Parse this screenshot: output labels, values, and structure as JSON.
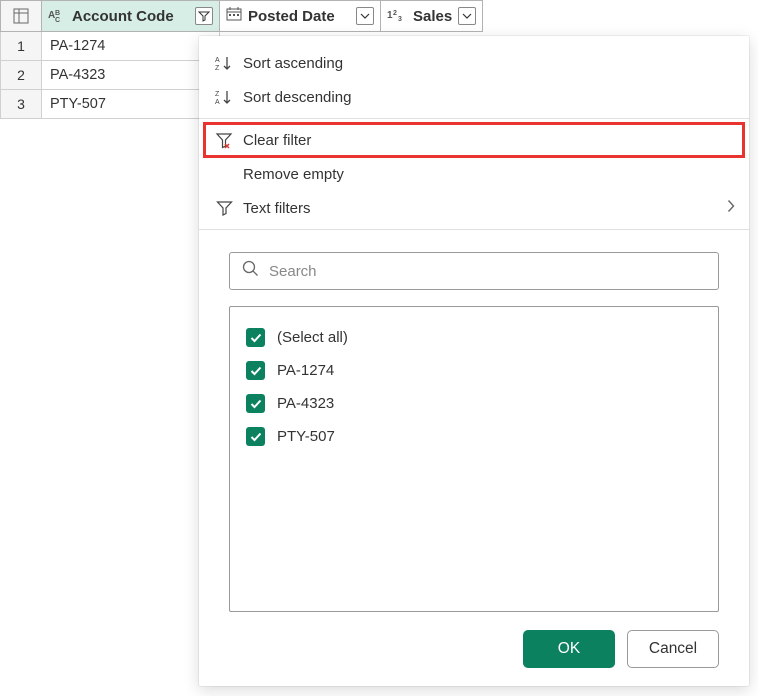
{
  "columns": [
    {
      "label": "Account Code",
      "type": "text",
      "filtered": true
    },
    {
      "label": "Posted Date",
      "type": "date",
      "filtered": false
    },
    {
      "label": "Sales",
      "type": "number",
      "filtered": false
    }
  ],
  "rows": [
    {
      "num": "1",
      "account_code": "PA-1274"
    },
    {
      "num": "2",
      "account_code": "PA-4323"
    },
    {
      "num": "3",
      "account_code": "PTY-507"
    }
  ],
  "menu": {
    "sort_asc": "Sort ascending",
    "sort_desc": "Sort descending",
    "clear_filter": "Clear filter",
    "remove_empty": "Remove empty",
    "text_filters": "Text filters"
  },
  "search": {
    "placeholder": "Search"
  },
  "filter_options": [
    {
      "label": "(Select all)",
      "checked": true
    },
    {
      "label": "PA-1274",
      "checked": true
    },
    {
      "label": "PA-4323",
      "checked": true
    },
    {
      "label": "PTY-507",
      "checked": true
    }
  ],
  "buttons": {
    "ok": "OK",
    "cancel": "Cancel"
  }
}
